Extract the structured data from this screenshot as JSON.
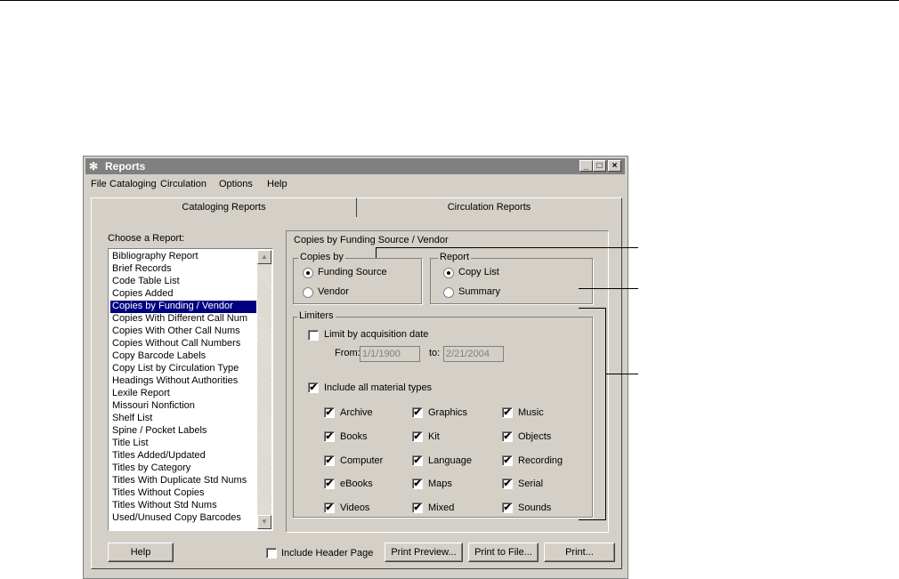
{
  "window": {
    "title": "Reports",
    "minimize": "_",
    "maximize": "□",
    "close": "×"
  },
  "menu": [
    "File",
    "Cataloging",
    "Circulation",
    "Options",
    "Help"
  ],
  "tabs": {
    "cataloging": "Cataloging Reports",
    "circulation": "Circulation Reports"
  },
  "report_list": {
    "label": "Choose a Report:",
    "items": [
      "Bibliography Report",
      "Brief Records",
      "Code Table List",
      "Copies Added",
      "Copies by Funding / Vendor",
      "Copies With Different Call Num",
      "Copies With Other Call Nums",
      "Copies Without Call Numbers",
      "Copy Barcode Labels",
      "Copy List by Circulation Type",
      "Headings Without Authorities",
      "Lexile Report",
      "Missouri Nonfiction",
      "Shelf List",
      "Spine / Pocket Labels",
      "Title List",
      "Titles Added/Updated",
      "Titles by Category",
      "Titles With Duplicate Std Nums",
      "Titles Without Copies",
      "Titles Without Std Nums",
      "Used/Unused Copy Barcodes"
    ],
    "selected": "Copies by Funding / Vendor"
  },
  "panel": {
    "title": "Copies by Funding Source / Vendor",
    "copies_by": {
      "label": "Copies by",
      "options": [
        "Funding Source",
        "Vendor"
      ],
      "selected": "Funding Source"
    },
    "report": {
      "label": "Report",
      "options": [
        "Copy List",
        "Summary"
      ],
      "selected": "Copy List"
    },
    "limiters": {
      "label": "Limiters",
      "limit_by_date": {
        "label": "Limit by acquisition date",
        "checked": false
      },
      "from_label": "From:",
      "from_value": "1/1/1900",
      "to_label": "to:",
      "to_value": "2/21/2004",
      "include_all": {
        "label": "Include all material types",
        "checked": true
      },
      "material_types": [
        [
          "Archive",
          "Graphics",
          "Music"
        ],
        [
          "Books",
          "Kit",
          "Objects"
        ],
        [
          "Computer",
          "Language",
          "Recording"
        ],
        [
          "eBooks",
          "Maps",
          "Serial"
        ],
        [
          "Videos",
          "Mixed",
          "Sounds"
        ]
      ]
    }
  },
  "footer": {
    "help": "Help",
    "include_header": {
      "label": "Include Header Page",
      "checked": false
    },
    "print_preview": "Print Preview...",
    "print_to_file": "Print to File...",
    "print": "Print..."
  },
  "check_mark": "✔"
}
